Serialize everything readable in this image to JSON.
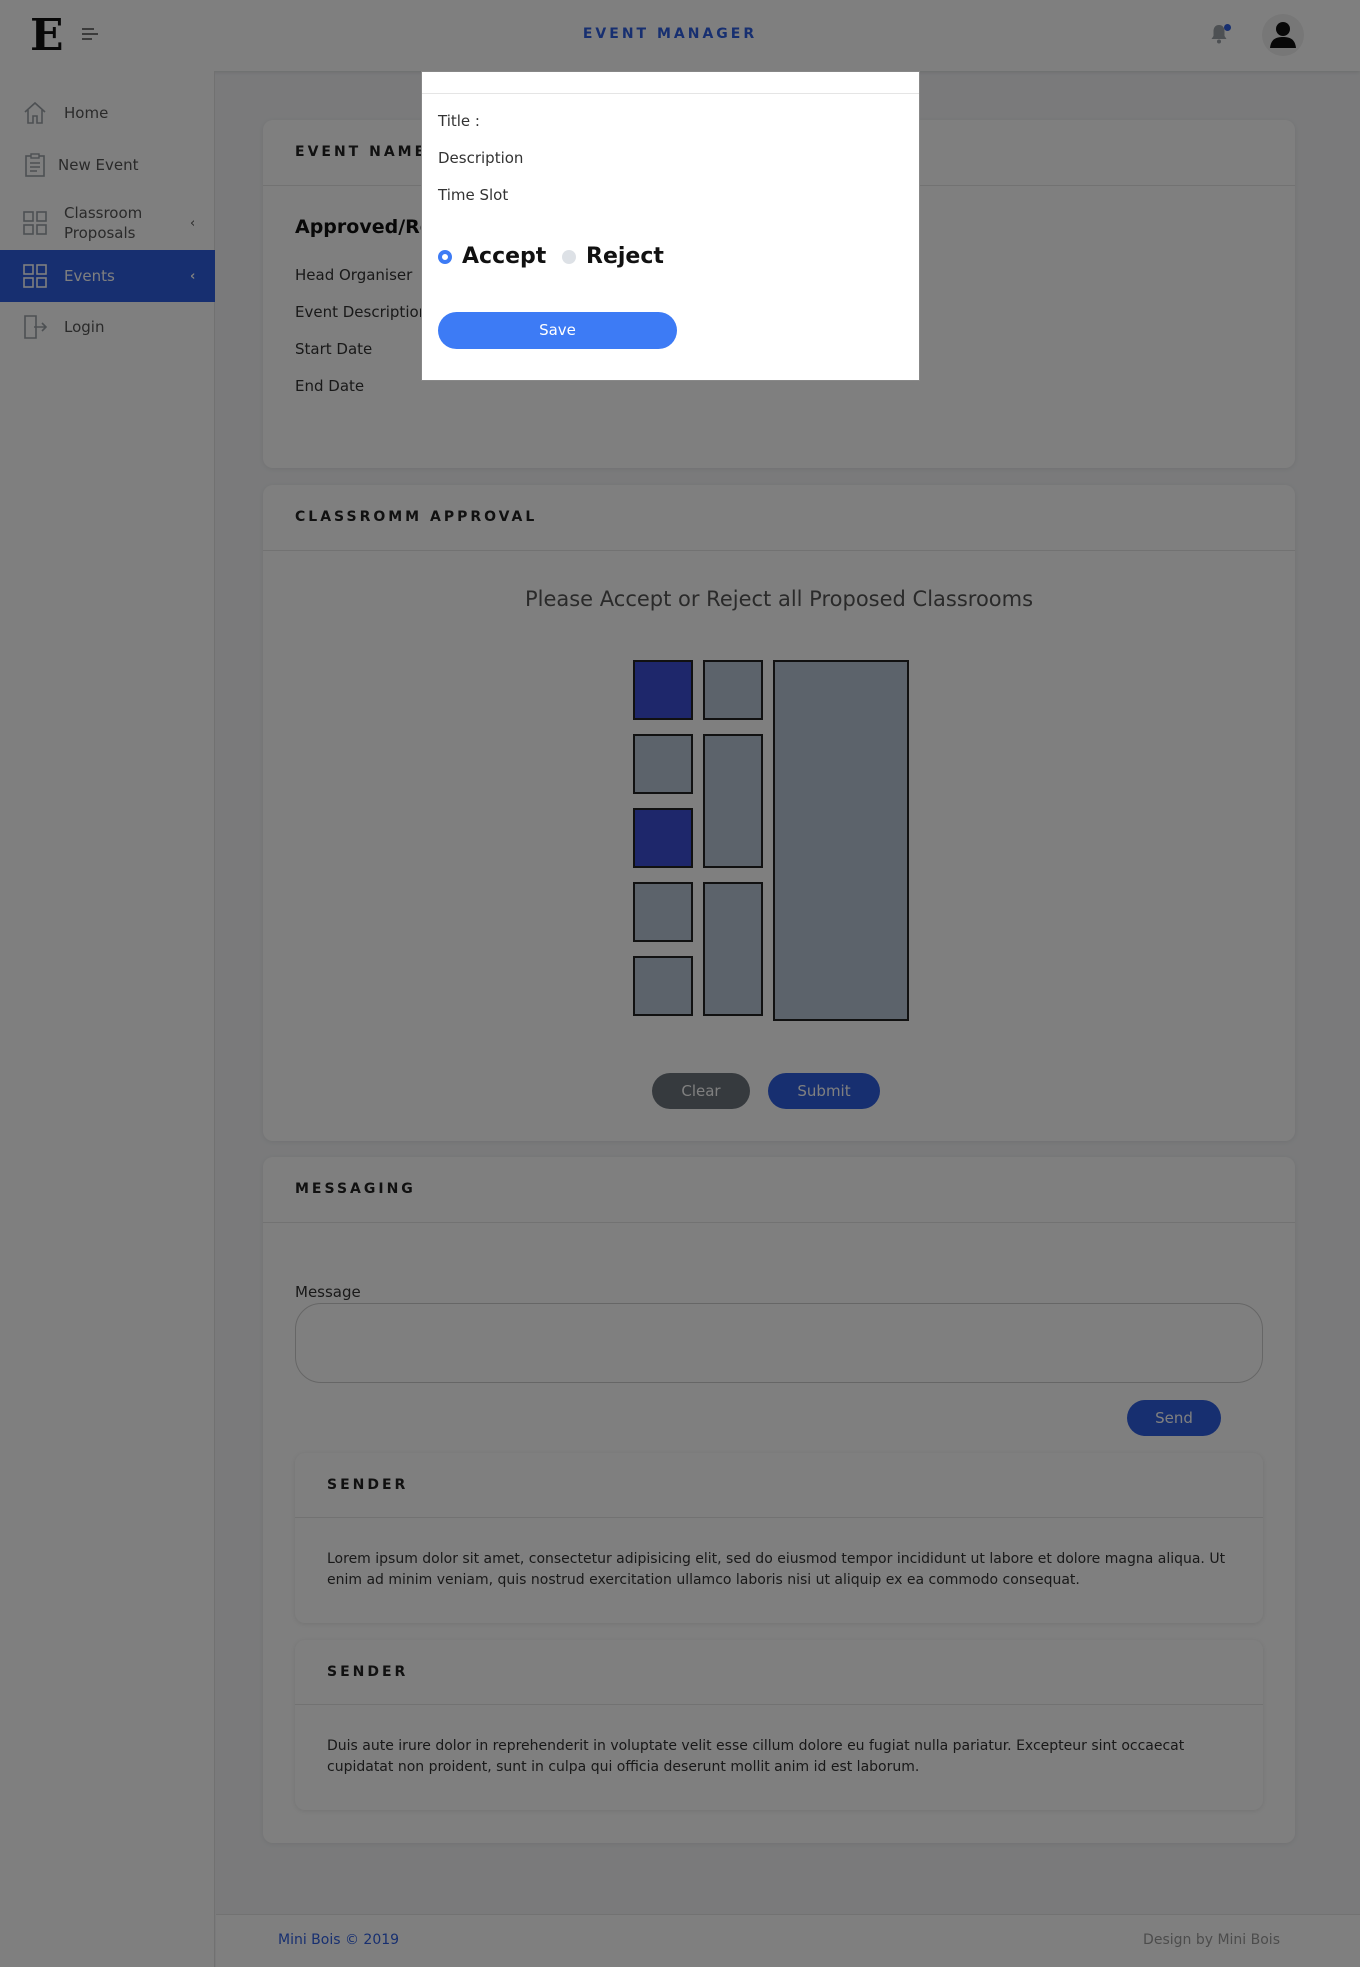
{
  "header": {
    "logo": "E",
    "title": "EVENT MANAGER"
  },
  "sidebar": {
    "items": [
      {
        "label": "Home",
        "icon": "home-icon"
      },
      {
        "label": "New Event",
        "icon": "clipboard-icon"
      },
      {
        "label": "Classroom Proposals",
        "icon": "grid-icon",
        "chevron": "‹"
      },
      {
        "label": "Events",
        "icon": "grid-icon",
        "chevron": "‹",
        "active": true
      },
      {
        "label": "Login",
        "icon": "login-icon"
      }
    ]
  },
  "event_card": {
    "title": "EVENT NAME",
    "status_heading": "Approved/Rejected",
    "fields": [
      "Head Organiser",
      "Event Description",
      "Start Date",
      "End Date"
    ]
  },
  "classroom_card": {
    "title": "CLASSROMM APPROVAL",
    "prompt": "Please Accept or Reject all Proposed Classrooms",
    "clear_label": "Clear",
    "submit_label": "Submit",
    "rooms_selected": [
      true,
      false,
      false,
      false,
      true,
      false,
      false,
      false,
      false
    ]
  },
  "messaging_card": {
    "title": "MESSAGING",
    "message_label": "Message",
    "message_value": "",
    "send_label": "Send",
    "messages": [
      {
        "sender": "SENDER",
        "body": "Lorem ipsum dolor sit amet, consectetur adipisicing elit, sed do eiusmod tempor incididunt ut labore et dolore magna aliqua. Ut enim ad minim veniam, quis nostrud exercitation ullamco laboris nisi ut aliquip ex ea commodo consequat."
      },
      {
        "sender": "SENDER",
        "body": "Duis aute irure dolor in reprehenderit in voluptate velit esse cillum dolore eu fugiat nulla pariatur. Excepteur sint occaecat cupidatat non proident, sunt in culpa qui officia deserunt mollit anim id est laborum."
      }
    ]
  },
  "footer": {
    "left": "Mini Bois © 2019",
    "right": "Design by Mini Bois"
  },
  "modal": {
    "title_label": "Title :",
    "description_label": "Description",
    "timeslot_label": "Time Slot",
    "accept_label": "Accept",
    "reject_label": "Reject",
    "selected": "Accept",
    "save_label": "Save"
  },
  "colors": {
    "accent": "#2f5fe0",
    "modal_button": "#3d7bf5",
    "room": "#b8c7d6",
    "room_selected": "#3c4fd6"
  }
}
